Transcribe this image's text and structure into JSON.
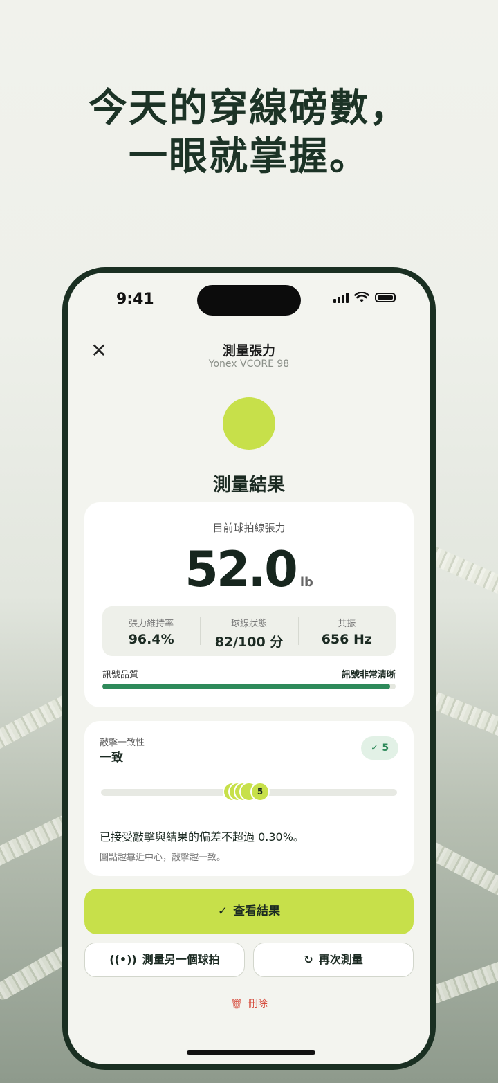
{
  "headline": {
    "line1": "今天的穿線磅數，",
    "line2": "一眼就掌握。"
  },
  "status_bar": {
    "time": "9:41"
  },
  "nav": {
    "title": "測量張力",
    "subtitle": "Yonex VCORE 98"
  },
  "result_title": "測量結果",
  "tension_card": {
    "label": "目前球拍線張力",
    "value": "52.0",
    "unit": "lb",
    "stats": [
      {
        "label": "張力維持率",
        "value": "96.4%"
      },
      {
        "label": "球線狀態",
        "value": "82/100 分"
      },
      {
        "label": "共振",
        "value": "656 Hz"
      }
    ],
    "signal": {
      "label": "訊號品質",
      "status": "訊號非常清晰",
      "level": 0.98
    }
  },
  "consistency_card": {
    "label": "敲擊一致性",
    "value": "一致",
    "badge_count": "5",
    "dot_count_label": "5",
    "description": "已接受敲擊與結果的偏差不超過 0.30%。",
    "note": "圓點越靠近中心，敲擊越一致。"
  },
  "actions": {
    "primary": "查看結果",
    "measure_other": "測量另一個球拍",
    "measure_again": "再次測量",
    "delete": "刪除"
  },
  "colors": {
    "accent": "#c7e04a",
    "dark": "#1b2a22",
    "success": "#2e8a5a",
    "danger": "#d64a3b"
  }
}
